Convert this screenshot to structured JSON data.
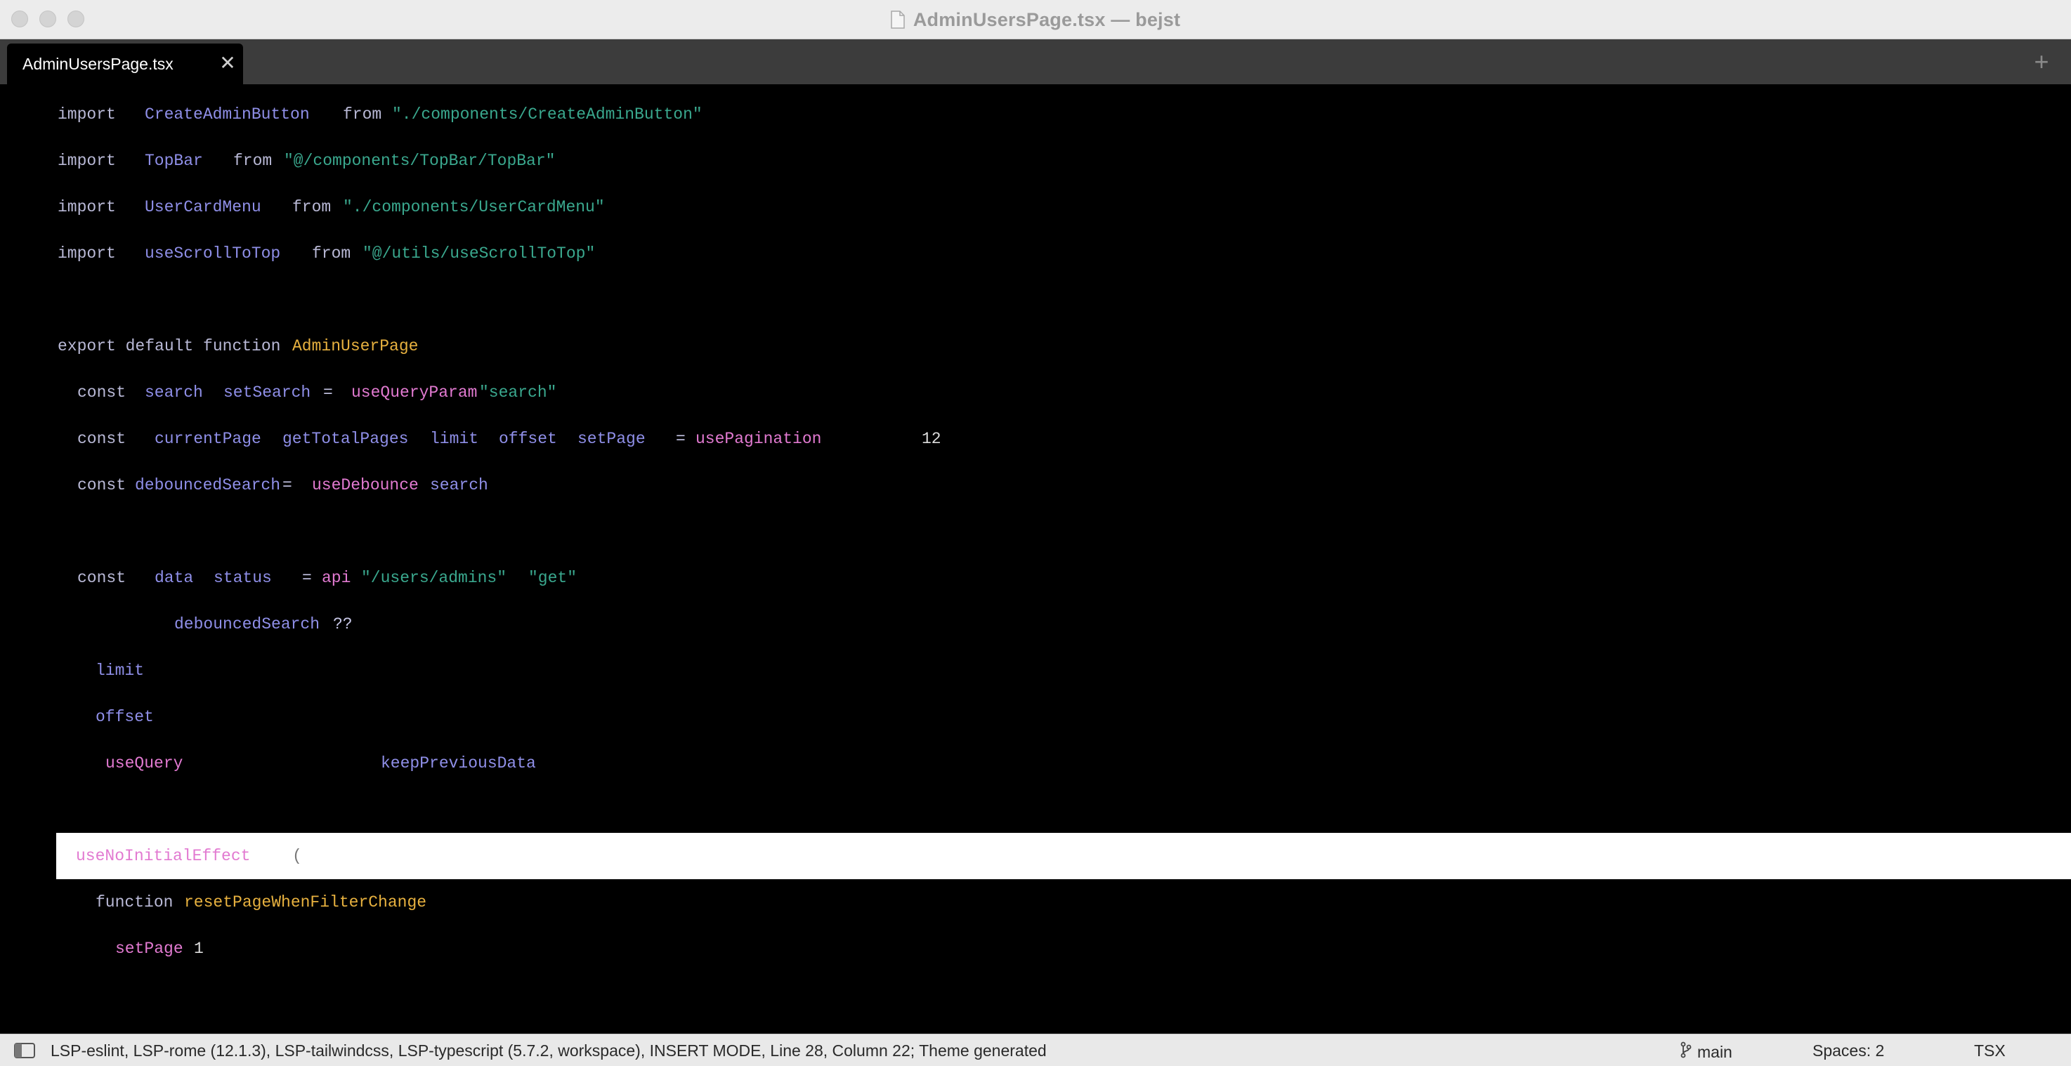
{
  "window": {
    "title": "AdminUsersPage.tsx — bejst"
  },
  "tabs": [
    {
      "label": "AdminUsersPage.tsx",
      "close_glyph": "✕",
      "active": true
    }
  ],
  "new_tab_glyph": "+",
  "editor": {
    "lines": [
      {
        "tokens": [
          {
            "t": "import",
            "c": "kw"
          },
          {
            "t": "CreateAdminButton",
            "c": "id"
          },
          {
            "t": "from",
            "c": "kw"
          },
          {
            "t": "\"./components/CreateAdminButton\"",
            "c": "str"
          }
        ]
      },
      {
        "tokens": [
          {
            "t": "import",
            "c": "kw"
          },
          {
            "t": "TopBar",
            "c": "id"
          },
          {
            "t": "from",
            "c": "kw"
          },
          {
            "t": "\"@/components/TopBar/TopBar\"",
            "c": "str"
          }
        ]
      },
      {
        "tokens": [
          {
            "t": "import",
            "c": "kw"
          },
          {
            "t": "UserCardMenu",
            "c": "id"
          },
          {
            "t": "from",
            "c": "kw"
          },
          {
            "t": "\"./components/UserCardMenu\"",
            "c": "str"
          }
        ]
      },
      {
        "tokens": [
          {
            "t": "import",
            "c": "kw"
          },
          {
            "t": "useScrollToTop",
            "c": "id"
          },
          {
            "t": "from",
            "c": "kw"
          },
          {
            "t": "\"@/utils/useScrollToTop\"",
            "c": "str"
          }
        ]
      },
      {
        "tokens": []
      },
      {
        "tokens": [
          {
            "t": "export default function",
            "c": "kw"
          },
          {
            "t": "AdminUserPage",
            "c": "decl"
          }
        ]
      },
      {
        "tokens": [
          {
            "t": "const",
            "c": "kw"
          },
          {
            "t": "search",
            "c": "id"
          },
          {
            "t": "setSearch",
            "c": "id"
          },
          {
            "t": "=",
            "c": "op"
          },
          {
            "t": "useQueryParam",
            "c": "fn"
          },
          {
            "t": "\"search\"",
            "c": "str"
          }
        ]
      },
      {
        "tokens": [
          {
            "t": "const",
            "c": "kw"
          },
          {
            "t": "currentPage",
            "c": "id"
          },
          {
            "t": "getTotalPages",
            "c": "id"
          },
          {
            "t": "limit",
            "c": "id"
          },
          {
            "t": "offset",
            "c": "id"
          },
          {
            "t": "setPage",
            "c": "id"
          },
          {
            "t": "=",
            "c": "op"
          },
          {
            "t": "usePagination",
            "c": "fn"
          },
          {
            "t": "12",
            "c": "num"
          }
        ]
      },
      {
        "tokens": [
          {
            "t": "const",
            "c": "kw"
          },
          {
            "t": "debouncedSearch",
            "c": "id"
          },
          {
            "t": "=",
            "c": "op"
          },
          {
            "t": "useDebounce",
            "c": "fn"
          },
          {
            "t": "search",
            "c": "id"
          }
        ]
      },
      {
        "tokens": []
      },
      {
        "tokens": [
          {
            "t": "const",
            "c": "kw"
          },
          {
            "t": "data",
            "c": "id"
          },
          {
            "t": "status",
            "c": "id"
          },
          {
            "t": "=",
            "c": "op"
          },
          {
            "t": "api",
            "c": "fn"
          },
          {
            "t": "\"/users/admins\"",
            "c": "str"
          },
          {
            "t": "\"get\"",
            "c": "str"
          }
        ]
      },
      {
        "tokens": [
          {
            "t": "debouncedSearch",
            "c": "id"
          },
          {
            "t": "??",
            "c": "op"
          }
        ]
      },
      {
        "tokens": [
          {
            "t": "limit",
            "c": "id"
          }
        ]
      },
      {
        "tokens": [
          {
            "t": "offset",
            "c": "id"
          }
        ]
      },
      {
        "tokens": [
          {
            "t": "useQuery",
            "c": "fn"
          },
          {
            "t": "keepPreviousData",
            "c": "id"
          }
        ]
      },
      {
        "tokens": []
      },
      {
        "current": true,
        "tokens": [
          {
            "t": "useNoInitialEffect",
            "c": "fn-cur"
          },
          {
            "t": "(",
            "c": "op-cur"
          }
        ]
      },
      {
        "tokens": [
          {
            "t": "function",
            "c": "kw"
          },
          {
            "t": "resetPageWhenFilterChange",
            "c": "decl"
          }
        ]
      },
      {
        "tokens": [
          {
            "t": "setPage",
            "c": "fn"
          },
          {
            "t": "1",
            "c": "num"
          }
        ]
      }
    ]
  },
  "statusbar": {
    "text": "LSP-eslint, LSP-rome (12.1.3), LSP-tailwindcss, LSP-typescript (5.7.2, workspace), INSERT MODE, Line 28, Column 22; Theme generated",
    "branch": "main",
    "spaces": "Spaces: 2",
    "syntax": "TSX"
  }
}
